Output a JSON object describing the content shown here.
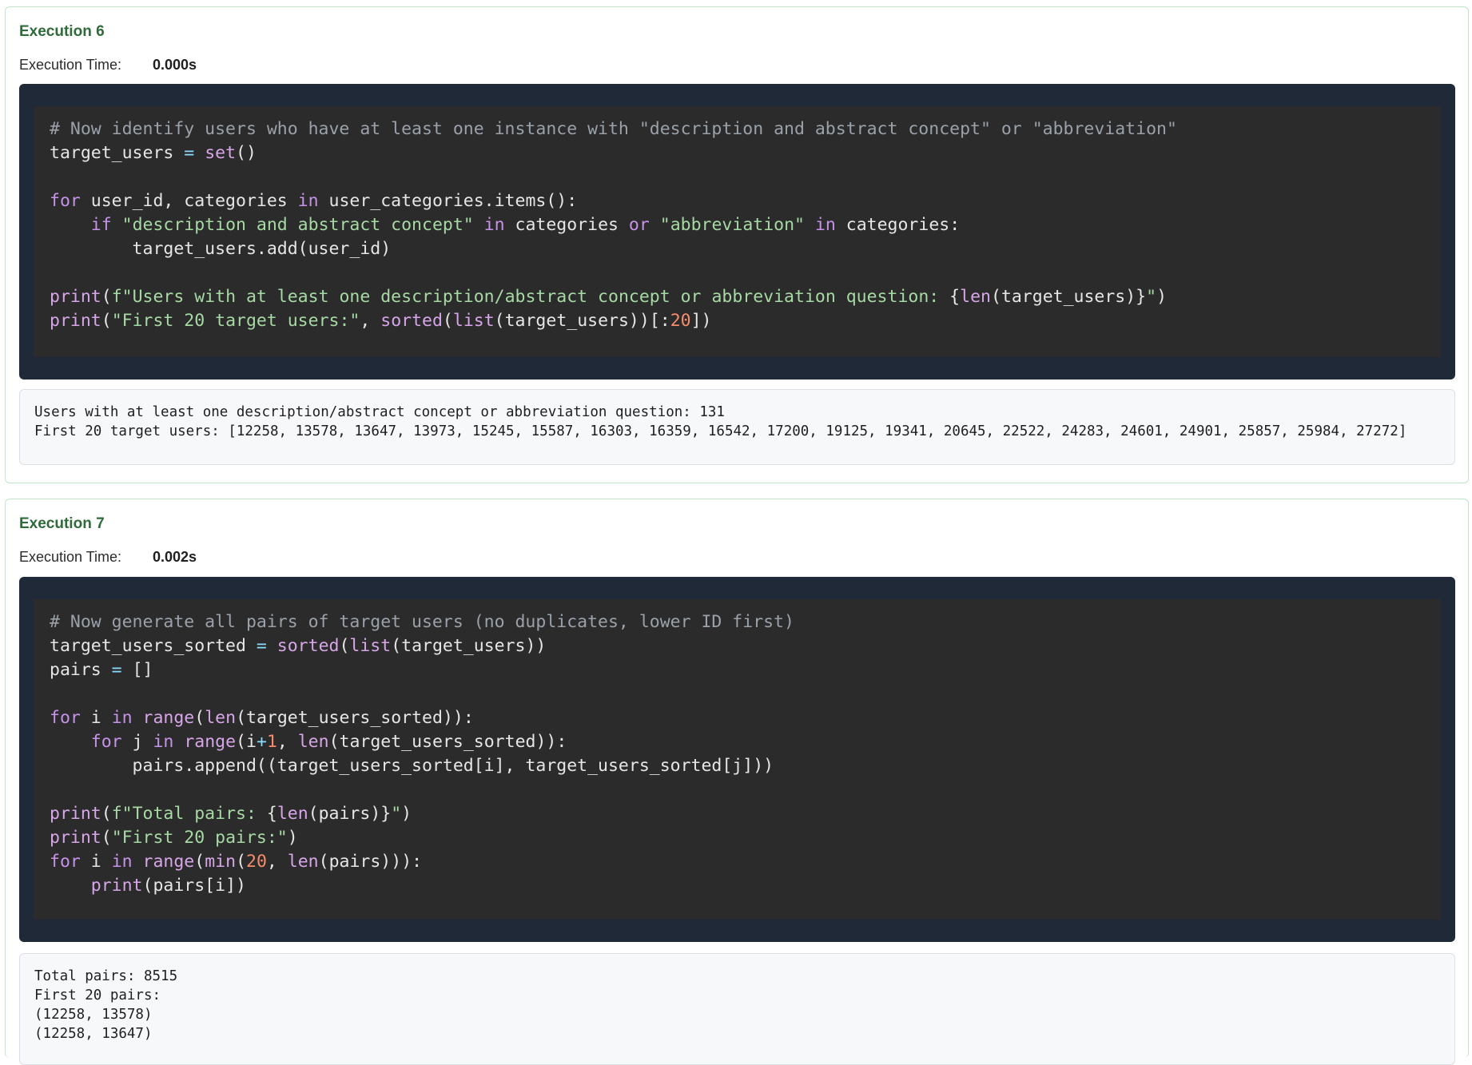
{
  "executions": [
    {
      "title": "Execution 6",
      "time_label": "Execution Time:",
      "time_value": "0.000s",
      "code_lines": [
        [
          [
            "cm",
            "# Now identify users who have at least one instance with \"description and abstract concept\" or \"abbreviation\""
          ]
        ],
        [
          [
            "pl",
            "target_users "
          ],
          [
            "op",
            "="
          ],
          [
            "pl",
            " "
          ],
          [
            "bi",
            "set"
          ],
          [
            "pl",
            "()"
          ]
        ],
        [],
        [
          [
            "kw",
            "for"
          ],
          [
            "pl",
            " user_id, categories "
          ],
          [
            "kw",
            "in"
          ],
          [
            "pl",
            " user_categories.items():"
          ]
        ],
        [
          [
            "pl",
            "    "
          ],
          [
            "kw",
            "if"
          ],
          [
            "pl",
            " "
          ],
          [
            "st",
            "\"description and abstract concept\""
          ],
          [
            "pl",
            " "
          ],
          [
            "kw",
            "in"
          ],
          [
            "pl",
            " categories "
          ],
          [
            "kw",
            "or"
          ],
          [
            "pl",
            " "
          ],
          [
            "st",
            "\"abbreviation\""
          ],
          [
            "pl",
            " "
          ],
          [
            "kw",
            "in"
          ],
          [
            "pl",
            " categories:"
          ]
        ],
        [
          [
            "pl",
            "        target_users.add(user_id)"
          ]
        ],
        [],
        [
          [
            "bi",
            "print"
          ],
          [
            "pl",
            "("
          ],
          [
            "st",
            "f\"Users with at least one description/abstract concept or abbreviation question: "
          ],
          [
            "pl",
            "{"
          ],
          [
            "bi",
            "len"
          ],
          [
            "pl",
            "(target_users)}"
          ],
          [
            "st",
            "\""
          ],
          [
            "pl",
            ")"
          ]
        ],
        [
          [
            "bi",
            "print"
          ],
          [
            "pl",
            "("
          ],
          [
            "st",
            "\"First 20 target users:\""
          ],
          [
            "pl",
            ", "
          ],
          [
            "bi",
            "sorted"
          ],
          [
            "pl",
            "("
          ],
          [
            "bi",
            "list"
          ],
          [
            "pl",
            "(target_users))[:"
          ],
          [
            "nu",
            "20"
          ],
          [
            "pl",
            "])"
          ]
        ]
      ],
      "output_lines": [
        "Users with at least one description/abstract concept or abbreviation question: 131",
        "First 20 target users: [12258, 13578, 13647, 13973, 15245, 15587, 16303, 16359, 16542, 17200, 19125, 19341, 20645, 22522, 24283, 24601, 24901, 25857, 25984, 27272]"
      ]
    },
    {
      "title": "Execution 7",
      "time_label": "Execution Time:",
      "time_value": "0.002s",
      "code_lines": [
        [
          [
            "cm",
            "# Now generate all pairs of target users (no duplicates, lower ID first)"
          ]
        ],
        [
          [
            "pl",
            "target_users_sorted "
          ],
          [
            "op",
            "="
          ],
          [
            "pl",
            " "
          ],
          [
            "bi",
            "sorted"
          ],
          [
            "pl",
            "("
          ],
          [
            "bi",
            "list"
          ],
          [
            "pl",
            "(target_users))"
          ]
        ],
        [
          [
            "pl",
            "pairs "
          ],
          [
            "op",
            "="
          ],
          [
            "pl",
            " []"
          ]
        ],
        [],
        [
          [
            "kw",
            "for"
          ],
          [
            "pl",
            " i "
          ],
          [
            "kw",
            "in"
          ],
          [
            "pl",
            " "
          ],
          [
            "bi",
            "range"
          ],
          [
            "pl",
            "("
          ],
          [
            "bi",
            "len"
          ],
          [
            "pl",
            "(target_users_sorted)):"
          ]
        ],
        [
          [
            "pl",
            "    "
          ],
          [
            "kw",
            "for"
          ],
          [
            "pl",
            " j "
          ],
          [
            "kw",
            "in"
          ],
          [
            "pl",
            " "
          ],
          [
            "bi",
            "range"
          ],
          [
            "pl",
            "(i"
          ],
          [
            "op",
            "+"
          ],
          [
            "nu",
            "1"
          ],
          [
            "pl",
            ", "
          ],
          [
            "bi",
            "len"
          ],
          [
            "pl",
            "(target_users_sorted)):"
          ]
        ],
        [
          [
            "pl",
            "        pairs.append((target_users_sorted[i], target_users_sorted[j]))"
          ]
        ],
        [],
        [
          [
            "bi",
            "print"
          ],
          [
            "pl",
            "("
          ],
          [
            "st",
            "f\"Total pairs: "
          ],
          [
            "pl",
            "{"
          ],
          [
            "bi",
            "len"
          ],
          [
            "pl",
            "(pairs)}"
          ],
          [
            "st",
            "\""
          ],
          [
            "pl",
            ")"
          ]
        ],
        [
          [
            "bi",
            "print"
          ],
          [
            "pl",
            "("
          ],
          [
            "st",
            "\"First 20 pairs:\""
          ],
          [
            "pl",
            ")"
          ]
        ],
        [
          [
            "kw",
            "for"
          ],
          [
            "pl",
            " i "
          ],
          [
            "kw",
            "in"
          ],
          [
            "pl",
            " "
          ],
          [
            "bi",
            "range"
          ],
          [
            "pl",
            "("
          ],
          [
            "bi",
            "min"
          ],
          [
            "pl",
            "("
          ],
          [
            "nu",
            "20"
          ],
          [
            "pl",
            ", "
          ],
          [
            "bi",
            "len"
          ],
          [
            "pl",
            "(pairs))):"
          ]
        ],
        [
          [
            "pl",
            "    "
          ],
          [
            "bi",
            "print"
          ],
          [
            "pl",
            "(pairs[i])"
          ]
        ]
      ],
      "output_lines": [
        "Total pairs: 8515",
        "First 20 pairs:",
        "(12258, 13578)",
        "(12258, 13647)"
      ]
    }
  ]
}
